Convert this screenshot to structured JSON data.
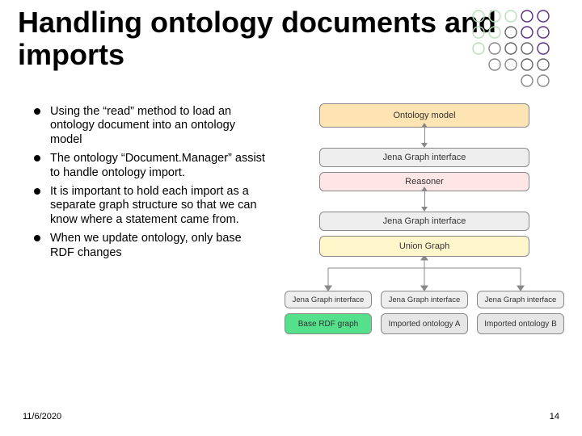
{
  "title": "Handling ontology documents and imports",
  "bullets": [
    "Using the “read” method to load an ontology document into an ontology model",
    "The ontology “Document.Manager” assist to handle ontology import.",
    "It is important to hold each import as a separate graph structure so that we can know where a statement came from.",
    "When we update ontology, only base RDF changes"
  ],
  "diagram": {
    "ontology_model": "Ontology model",
    "jena_graph_interface": "Jena Graph interface",
    "reasoner": "Reasoner",
    "union_graph": "Union Graph",
    "base_rdf_graph": "Base RDF graph",
    "imported_a": "Imported ontology A",
    "imported_b": "Imported ontology B"
  },
  "footer": {
    "date": "11/6/2020",
    "page": "14"
  },
  "colors": {
    "ontology_model_bg": "#ffe4b3",
    "jgi_bg": "#eeeeee",
    "reasoner_bg": "#ffe6e6",
    "union_bg": "#fff6cc",
    "base_bg": "#55e08c",
    "imported_bg": "#e6e6e6"
  }
}
